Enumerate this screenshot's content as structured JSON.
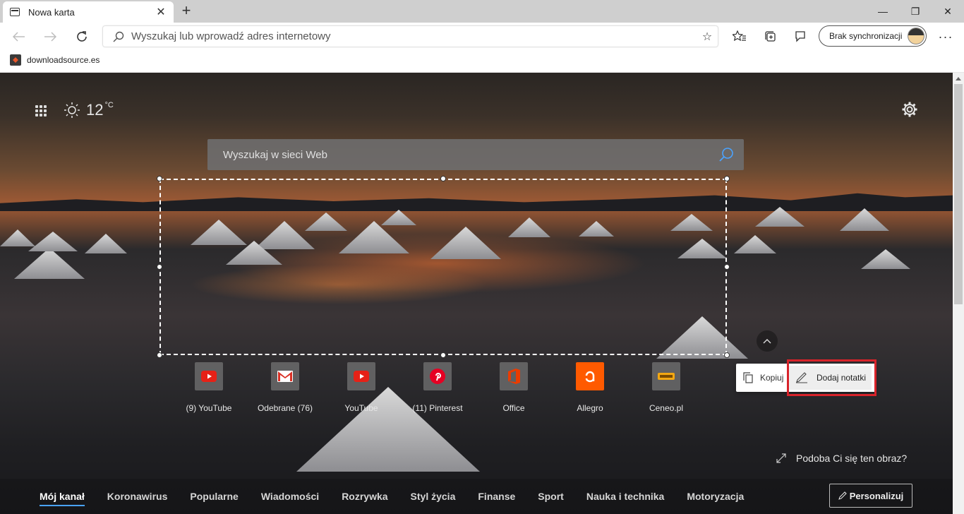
{
  "tab": {
    "title": "Nowa karta",
    "new_tab": "+"
  },
  "window": {
    "minimize": "—",
    "restore": "❐",
    "close": "✕"
  },
  "toolbar": {
    "address_placeholder": "Wyszukaj lub wprowadź adres internetowy",
    "sync_label": "Brak synchronizacji",
    "more": "···"
  },
  "favorites": [
    {
      "label": "downloadsource.es"
    }
  ],
  "ntp": {
    "weather": {
      "temp": "12",
      "unit": "°C"
    },
    "search_placeholder": "Wyszukaj w sieci Web",
    "tiles": [
      {
        "label": "(9) YouTube",
        "icon": "youtube-icon",
        "color": "#e62117"
      },
      {
        "label": "Odebrane (76)",
        "icon": "gmail-icon",
        "color": "#d93025"
      },
      {
        "label": "YouTube",
        "icon": "youtube-icon",
        "color": "#e62117"
      },
      {
        "label": "(11) Pinterest",
        "icon": "pinterest-icon",
        "color": "#e60023"
      },
      {
        "label": "Office",
        "icon": "office-icon",
        "color": "#eb3c00"
      },
      {
        "label": "Allegro",
        "icon": "allegro-icon",
        "color": "#ff5a00"
      },
      {
        "label": "Ceneo.pl",
        "icon": "ceneo-icon",
        "color": "#f3a712"
      }
    ],
    "context_menu": {
      "copy_label": "Kopiuj",
      "note_label": "Dodaj notatki"
    },
    "image_question": "Podoba Ci się ten obraz?",
    "feed_tabs": [
      {
        "label": "Mój kanał",
        "active": true
      },
      {
        "label": "Koronawirus"
      },
      {
        "label": "Popularne"
      },
      {
        "label": "Wiadomości"
      },
      {
        "label": "Rozrywka"
      },
      {
        "label": "Styl życia"
      },
      {
        "label": "Finanse"
      },
      {
        "label": "Sport"
      },
      {
        "label": "Nauka i technika"
      },
      {
        "label": "Motoryzacja"
      }
    ],
    "personalize_label": "Personalizuj"
  },
  "colors": {
    "highlight": "#d8232a",
    "accent": "#4aa3ff"
  }
}
